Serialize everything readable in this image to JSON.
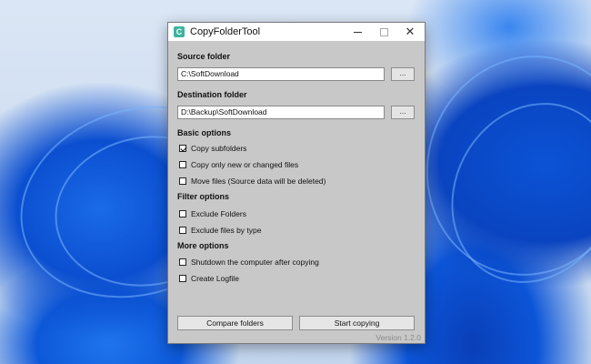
{
  "window": {
    "title": "CopyFolderTool",
    "icon_letter": "C",
    "icon_color": "#3db39e",
    "controls": {
      "minimize": "—",
      "maximize": "☐",
      "close": "✕"
    }
  },
  "source": {
    "label": "Source folder",
    "value": "C:\\SoftDownload",
    "browse_label": "..."
  },
  "destination": {
    "label": "Destination folder",
    "value": "D:\\Backup\\SoftDownload",
    "browse_label": "..."
  },
  "basic_options": {
    "label": "Basic options",
    "items": [
      {
        "label": "Copy subfolders",
        "checked": true
      },
      {
        "label": "Copy only new or changed files",
        "checked": false
      },
      {
        "label": "Move files (Source data will be deleted)",
        "checked": false
      }
    ]
  },
  "filter_options": {
    "label": "Filter options",
    "items": [
      {
        "label": "Exclude Folders",
        "checked": false
      },
      {
        "label": "Exclude files by type",
        "checked": false
      }
    ]
  },
  "more_options": {
    "label": "More options",
    "items": [
      {
        "label": "Shutdown the computer after copying",
        "checked": false
      },
      {
        "label": "Create Logfile",
        "checked": false
      }
    ]
  },
  "buttons": {
    "compare": "Compare folders",
    "start": "Start copying"
  },
  "version": "Version 1.2.0"
}
